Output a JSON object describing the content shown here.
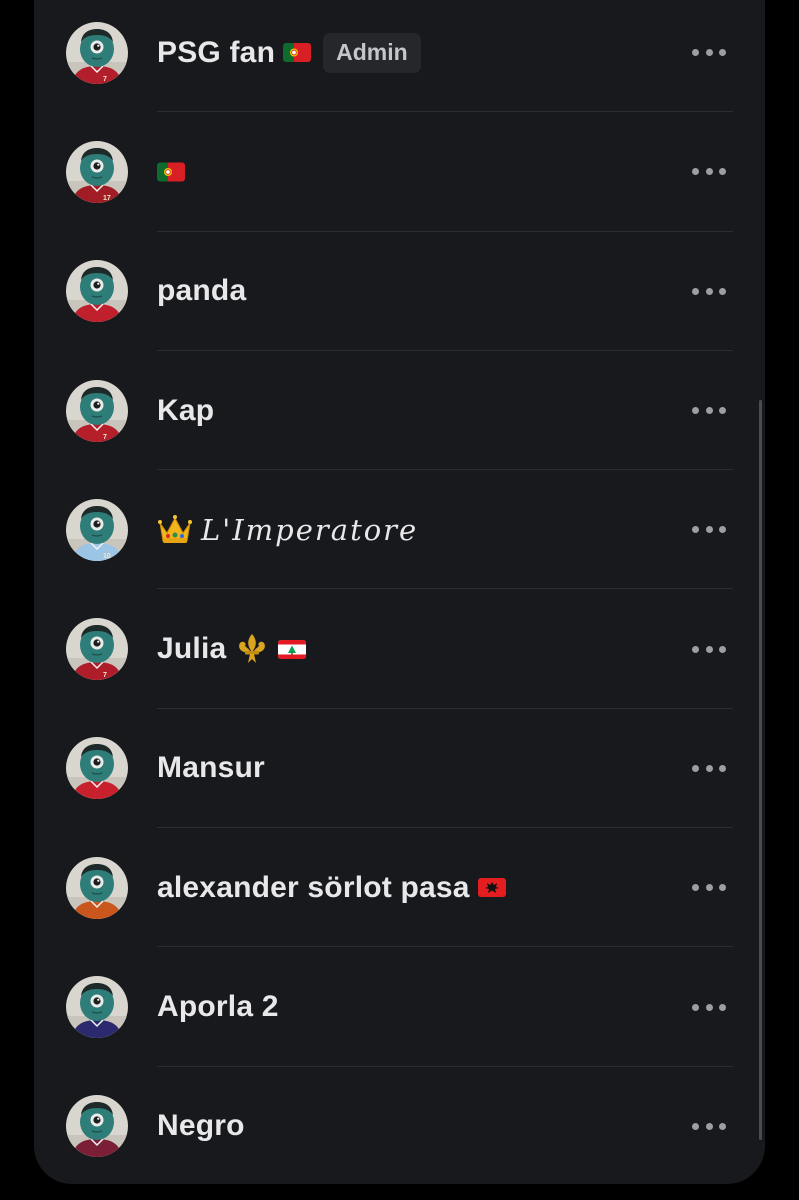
{
  "admin_badge": "Admin",
  "colors": {
    "background": "#18191d",
    "text": "#e8e8ea",
    "badge_bg": "#26272b",
    "divider": "#2c2d31",
    "avatar_skin": "#2f7d78"
  },
  "members": [
    {
      "name": "PSG fan",
      "flag": "portugal-flag",
      "admin": true,
      "jersey": "#b21e2b",
      "number": "7"
    },
    {
      "name": "",
      "flag": "portugal-flag",
      "admin": false,
      "jersey": "#a11d26",
      "number": "17"
    },
    {
      "name": "panda",
      "admin": false,
      "jersey": "#c0202b",
      "number": ""
    },
    {
      "name": "Kap",
      "admin": false,
      "jersey": "#b51f2a",
      "number": "7"
    },
    {
      "name": "L'Imperatore",
      "prefix_icon": "crown-icon",
      "admin": false,
      "jersey": "#9cc4e4",
      "number": "10"
    },
    {
      "name": "Julia",
      "suffix_icon": "fleur-de-lis-icon",
      "flag": "lebanon-flag",
      "admin": false,
      "jersey": "#b01d2a",
      "number": "7"
    },
    {
      "name": "Mansur",
      "admin": false,
      "jersey": "#c8202d",
      "number": ""
    },
    {
      "name": "alexander sörlot pasa",
      "flag": "albania-flag",
      "admin": false,
      "jersey": "#c9561c",
      "number": ""
    },
    {
      "name": "Aporla 2",
      "admin": false,
      "jersey": "#2b2a6e",
      "number": ""
    },
    {
      "name": "Negro",
      "admin": false,
      "jersey": "#7a1f36",
      "number": ""
    }
  ]
}
